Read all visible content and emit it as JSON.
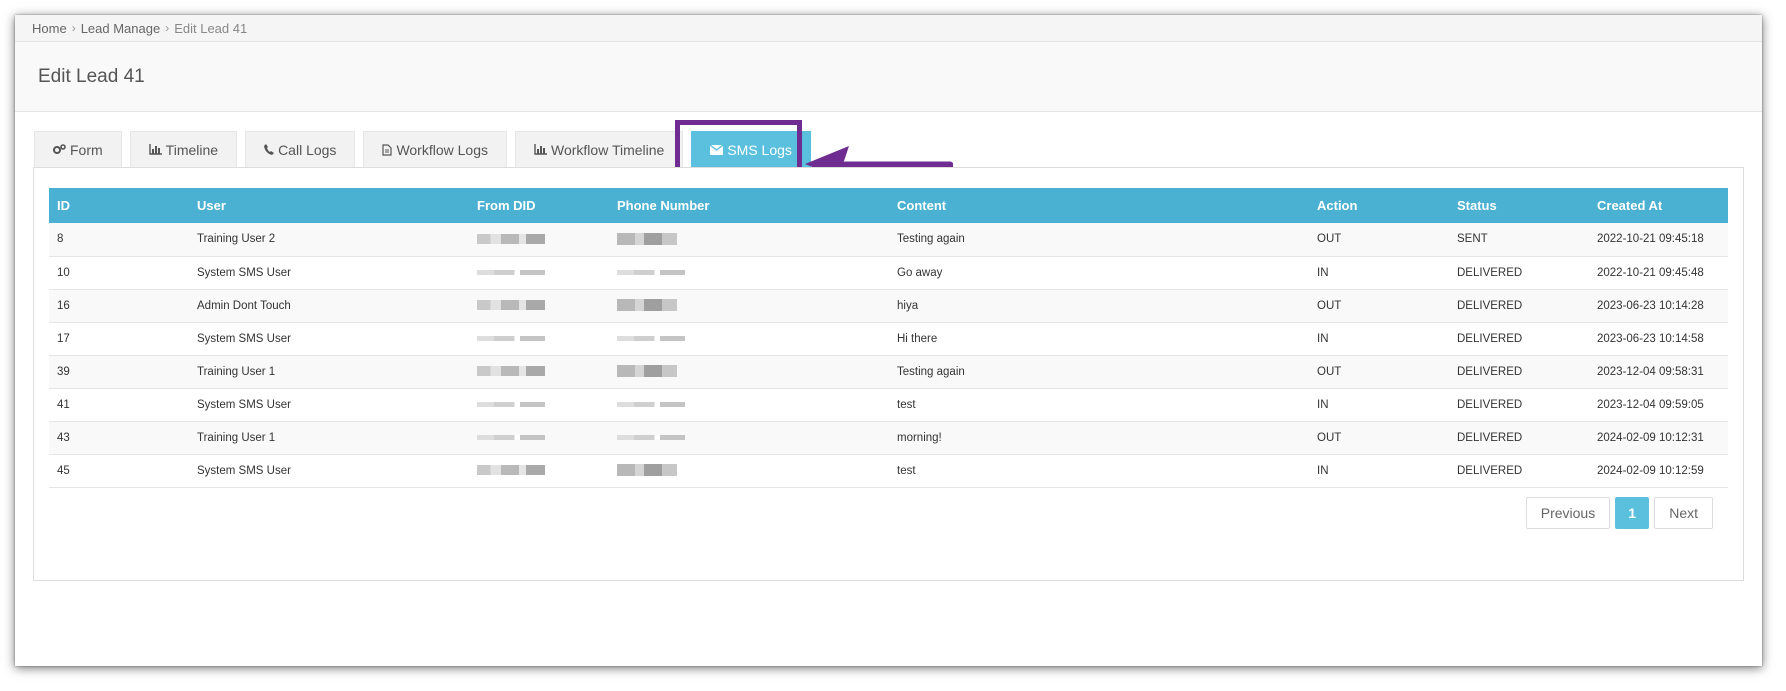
{
  "breadcrumb": [
    "Home",
    "Lead Manage",
    "Edit Lead 41"
  ],
  "page_title": "Edit Lead 41",
  "tabs": [
    {
      "label": "Form",
      "icon": "gears-icon"
    },
    {
      "label": "Timeline",
      "icon": "bar-chart-icon"
    },
    {
      "label": "Call Logs",
      "icon": "phone-icon"
    },
    {
      "label": "Workflow Logs",
      "icon": "document-icon"
    },
    {
      "label": "Workflow Timeline",
      "icon": "bar-chart-icon"
    },
    {
      "label": "SMS Logs",
      "icon": "envelope-icon",
      "active": true
    }
  ],
  "table": {
    "columns": [
      "ID",
      "User",
      "From DID",
      "Phone Number",
      "Content",
      "Action",
      "Status",
      "Created At"
    ],
    "rows": [
      {
        "id": "8",
        "user": "Training User 2",
        "content": "Testing again",
        "action": "OUT",
        "status": "SENT",
        "created_at": "2022-10-21 09:45:18"
      },
      {
        "id": "10",
        "user": "System SMS User",
        "content": "Go away",
        "action": "IN",
        "status": "DELIVERED",
        "created_at": "2022-10-21 09:45:48"
      },
      {
        "id": "16",
        "user": "Admin Dont Touch",
        "content": "hiya",
        "action": "OUT",
        "status": "DELIVERED",
        "created_at": "2023-06-23 10:14:28"
      },
      {
        "id": "17",
        "user": "System SMS User",
        "content": "Hi there",
        "action": "IN",
        "status": "DELIVERED",
        "created_at": "2023-06-23 10:14:58"
      },
      {
        "id": "39",
        "user": "Training User 1",
        "content": "Testing again",
        "action": "OUT",
        "status": "DELIVERED",
        "created_at": "2023-12-04 09:58:31"
      },
      {
        "id": "41",
        "user": "System SMS User",
        "content": "test",
        "action": "IN",
        "status": "DELIVERED",
        "created_at": "2023-12-04 09:59:05"
      },
      {
        "id": "43",
        "user": "Training User 1",
        "content": "morning!",
        "action": "OUT",
        "status": "DELIVERED",
        "created_at": "2024-02-09 10:12:31"
      },
      {
        "id": "45",
        "user": "System SMS User",
        "content": "test",
        "action": "IN",
        "status": "DELIVERED",
        "created_at": "2024-02-09 10:12:59"
      }
    ]
  },
  "pagination": {
    "previous": "Previous",
    "current": "1",
    "next": "Next"
  },
  "colors": {
    "accent": "#5bc0de",
    "table_header": "#4bb1d3",
    "annotation": "#6f2c91"
  }
}
